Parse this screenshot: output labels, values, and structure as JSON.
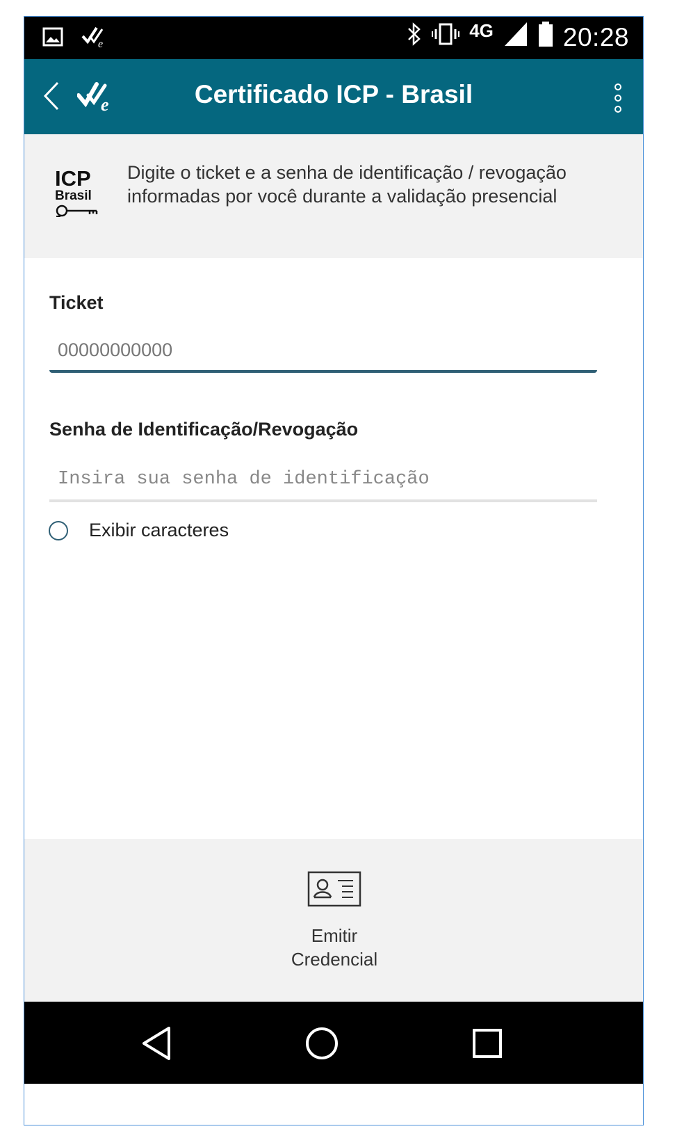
{
  "status_bar": {
    "time": "20:28",
    "network": "4G",
    "icons": [
      "image-icon",
      "app-check-icon",
      "bluetooth-icon",
      "vibrate-icon",
      "signal-icon",
      "battery-icon"
    ]
  },
  "app_bar": {
    "title": "Certificado ICP - Brasil",
    "background": "#05677f"
  },
  "info": {
    "logo_text_1": "ICP",
    "logo_text_2": "Brasil",
    "text": "Digite o ticket e a senha de identificação / revogação informadas por você durante a validação presencial"
  },
  "form": {
    "ticket_label": "Ticket",
    "ticket_placeholder": "00000000000",
    "senha_label": "Senha de Identificação/Revogação",
    "senha_placeholder": "Insira sua senha de identificação",
    "show_chars_label": "Exibir caracteres",
    "show_chars_checked": false
  },
  "footer": {
    "emit_line1": "Emitir",
    "emit_line2": "Credencial"
  },
  "nav_bar": {
    "buttons": [
      "back-nav-icon",
      "home-nav-icon",
      "recents-nav-icon"
    ]
  }
}
